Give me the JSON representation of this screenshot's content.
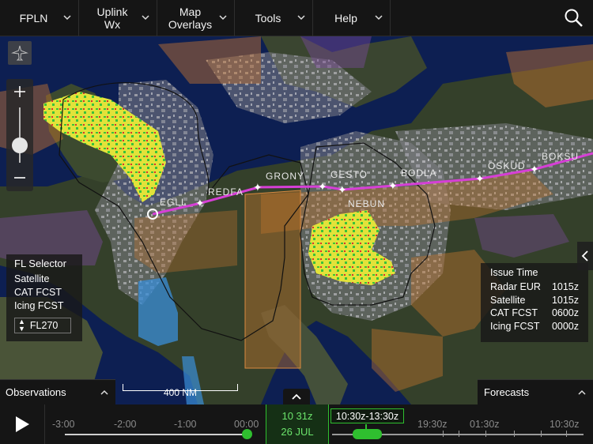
{
  "menu": {
    "fpln": "FPLN",
    "uplink": "Uplink\nWx",
    "overlays": "Map\nOverlays",
    "tools": "Tools",
    "help": "Help",
    "search_icon": "search-icon"
  },
  "map": {
    "waypoints": [
      "EGLL",
      "REDFA",
      "GRONY",
      "GESTO",
      "BODLA",
      "NEBUN",
      "OSKUD",
      "BOKSU"
    ],
    "route_color": "#d63fd6",
    "scale_label": "400 NM"
  },
  "fl_selector": {
    "title": "FL Selector",
    "items": [
      "Satellite",
      "CAT FCST",
      "Icing FCST"
    ],
    "level": "FL270"
  },
  "issue_time": {
    "title": "Issue Time",
    "rows": [
      {
        "name": "Radar EUR",
        "value": "1015z"
      },
      {
        "name": "Satellite",
        "value": "1015z"
      },
      {
        "name": "CAT FCST",
        "value": "0600z"
      },
      {
        "name": "Icing FCST",
        "value": "0000z"
      }
    ]
  },
  "tabs": {
    "observations": "Observations",
    "forecasts": "Forecasts"
  },
  "timeline": {
    "obs_labels": [
      "-3:00",
      "-2:00",
      "-1:00",
      "00:00"
    ],
    "now_time": "10 31z",
    "now_date": "26 JUL",
    "forecast_range": "10:30z-13:30z",
    "fc_labels": [
      "19:30z",
      "01:30z",
      "10:30z"
    ],
    "accent": "#2fbf2f"
  }
}
